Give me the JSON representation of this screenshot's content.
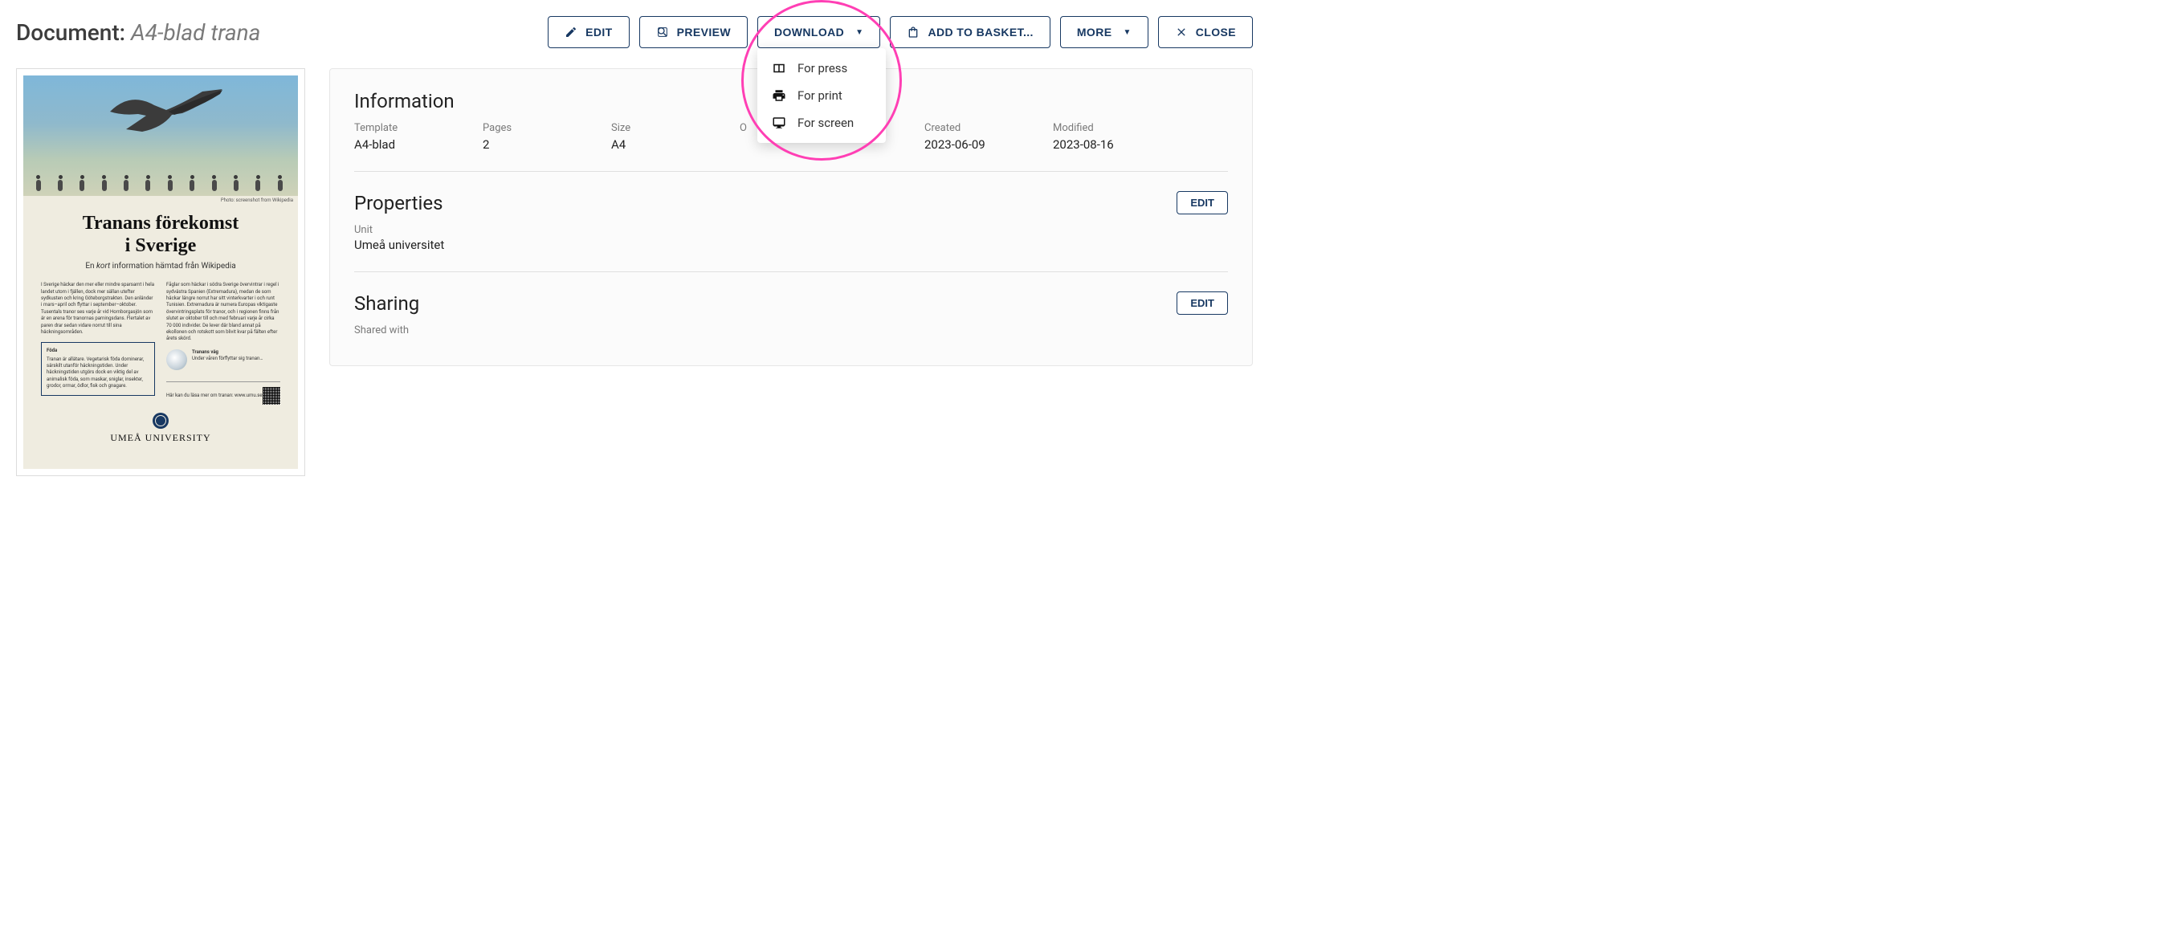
{
  "header": {
    "prefix": "Document:",
    "name": "A4-blad trana"
  },
  "actions": {
    "edit": "EDIT",
    "preview": "PREVIEW",
    "download": "DOWNLOAD",
    "add_to_basket": "ADD TO BASKET...",
    "more": "MORE",
    "close": "CLOSE"
  },
  "download_menu": {
    "press": "For press",
    "print": "For print",
    "screen": "For screen"
  },
  "preview_doc": {
    "photo_caption": "Photo: screenshot from Wikipedia",
    "title_line1": "Tranans förekomst",
    "title_line2": "i Sverige",
    "subtitle_pre": "En ",
    "subtitle_em": "kort",
    "subtitle_post": " information hämtad från Wikipedia",
    "col1": "I Sverige häckar den mer eller mindre sparsamt i hela landet utom i fjällen, dock mer sällan utefter sydkusten och kring Göteborgstrakten. Den anländer i mars–april och flyttar i september–oktober. Tusentals tranor ses varje år vid Hornborgasjön som är en arena för tranornas parningsdans. Flertalet av paren drar sedan vidare norrut till sina häckningsområden.",
    "col2": "Fåglar som häckar i södra Sverige övervintrar i regel i sydvästra Spanien (Extremadura), medan de som häckar längre norrut har sitt vinterkvarter i och runt Tunisien. Extremadura är numera Europas viktigaste övervintringsplats för tranor, och i regionen finns från slutet av oktober till och med februari varje år cirka 70 000 individer. De lever där bland annat på ekollonen och rotskott som blivit kvar på fälten efter årets skörd.",
    "box_title": "Föda",
    "box_body": "Tranan är allätare. Vegetarisk föda dominerar, särskilt utanför häckningstiden. Under häckningstiden utgörs dock en viktig del av animalisk föda, som maskar, sniglar, insekter, grodor, ormar, ödlor, fisk och gnagare.",
    "side_title": "Tranans väg",
    "side_body": "Under våren förflyttar sig tranan…",
    "footer_left": "Här kan du läsa mer om tranan: www.umu.se",
    "university": "UMEÅ UNIVERSITY"
  },
  "info_section": {
    "title": "Information",
    "fields": {
      "template": {
        "label": "Template",
        "value": "A4-blad"
      },
      "pages": {
        "label": "Pages",
        "value": "2"
      },
      "size": {
        "label": "Size",
        "value": "A4"
      },
      "owner": {
        "label": "O",
        "value": ""
      },
      "created": {
        "label": "Created",
        "value": "2023-06-09"
      },
      "modified": {
        "label": "Modified",
        "value": "2023-08-16"
      }
    }
  },
  "properties_section": {
    "title": "Properties",
    "edit": "EDIT",
    "unit_label": "Unit",
    "unit_value": "Umeå universitet"
  },
  "sharing_section": {
    "title": "Sharing",
    "edit": "EDIT",
    "shared_label": "Shared with"
  }
}
